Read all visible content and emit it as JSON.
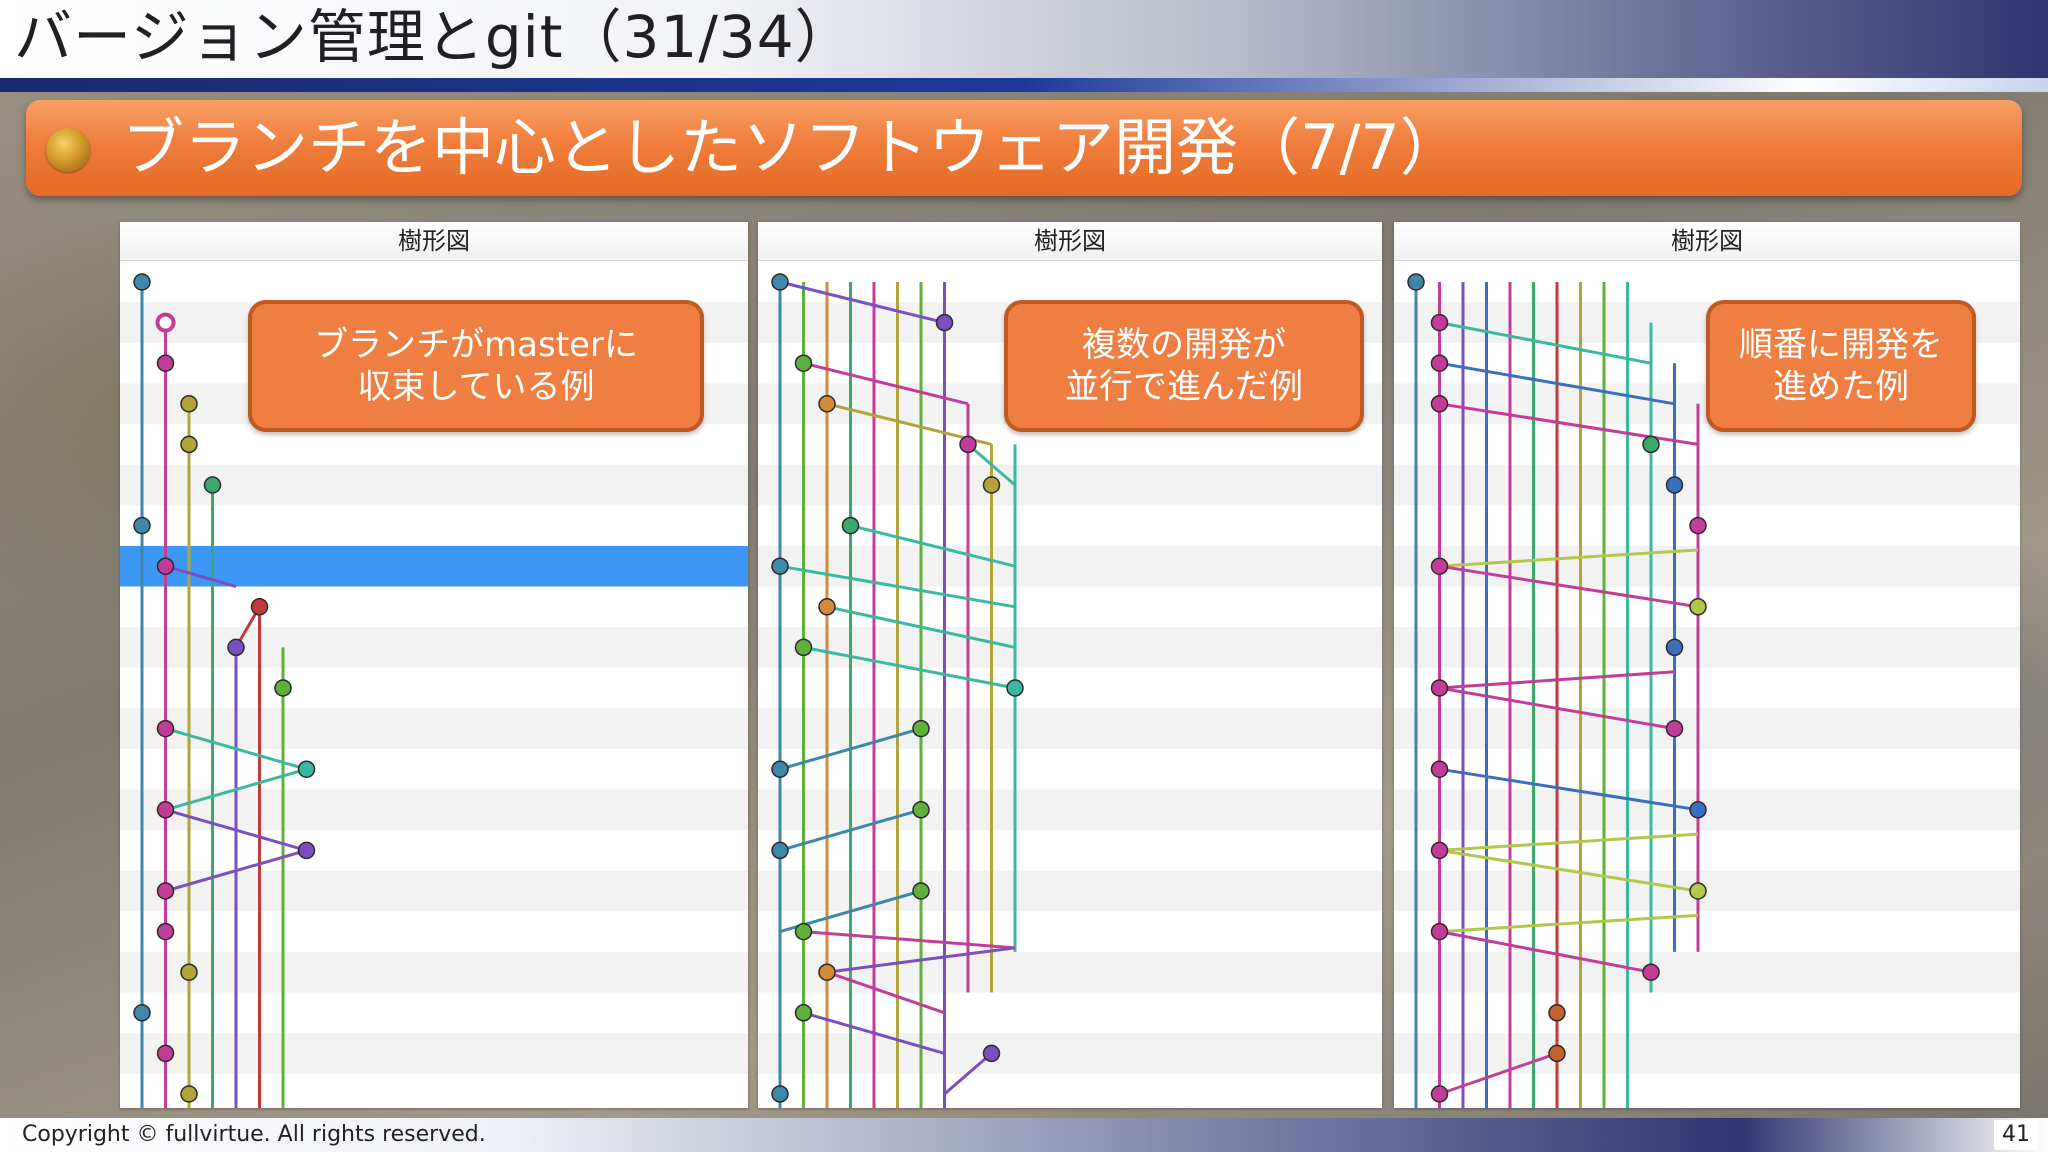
{
  "slide": {
    "title": "バージョン管理とgit（31/34）",
    "section_heading": "ブランチを中心としたソフトウェア開発（7/7）",
    "footer": "Copyright © fullvirtue.  All rights reserved.",
    "page_number": "41"
  },
  "panels": [
    {
      "header": "樹形図",
      "callout": "ブランチがmasterに\n収束している例",
      "selected_row": 7,
      "lanes": [
        {
          "color": "#3f87a8",
          "from": 0,
          "to": 20
        },
        {
          "color": "#c43c9a",
          "from": 1,
          "to": 20
        },
        {
          "color": "#b2a43a",
          "from": 3,
          "to": 20
        },
        {
          "color": "#3ca86e",
          "from": 5,
          "to": 20
        },
        {
          "color": "#7a4fc0",
          "from": 9,
          "to": 20
        },
        {
          "color": "#c23b3b",
          "from": 8,
          "to": 20
        },
        {
          "color": "#5fb03a",
          "from": 10,
          "to": 20
        }
      ],
      "commits": [
        {
          "row": 0,
          "lane": 0,
          "color": "#3f87a8"
        },
        {
          "row": 1,
          "lane": 1,
          "color": "#c43c9a",
          "hollow": true
        },
        {
          "row": 2,
          "lane": 1,
          "color": "#c43c9a"
        },
        {
          "row": 3,
          "lane": 2,
          "color": "#b2a43a"
        },
        {
          "row": 4,
          "lane": 2,
          "color": "#b2a43a"
        },
        {
          "row": 5,
          "lane": 3,
          "color": "#3ca86e"
        },
        {
          "row": 6,
          "lane": 0,
          "color": "#3f87a8"
        },
        {
          "row": 7,
          "lane": 1,
          "color": "#c43c9a"
        },
        {
          "row": 8,
          "lane": 5,
          "color": "#c23b3b"
        },
        {
          "row": 9,
          "lane": 4,
          "color": "#7a4fc0"
        },
        {
          "row": 10,
          "lane": 6,
          "color": "#5fb03a"
        },
        {
          "row": 11,
          "lane": 1,
          "color": "#c43c9a"
        },
        {
          "row": 12,
          "lane": 7,
          "color": "#3bb8a0"
        },
        {
          "row": 13,
          "lane": 1,
          "color": "#c43c9a"
        },
        {
          "row": 14,
          "lane": 7,
          "color": "#7a4fc0"
        },
        {
          "row": 15,
          "lane": 1,
          "color": "#c43c9a"
        },
        {
          "row": 16,
          "lane": 1,
          "color": "#c43c9a"
        },
        {
          "row": 17,
          "lane": 2,
          "color": "#b2a43a"
        },
        {
          "row": 18,
          "lane": 0,
          "color": "#3f87a8"
        },
        {
          "row": 19,
          "lane": 1,
          "color": "#c43c9a"
        },
        {
          "row": 20,
          "lane": 2,
          "color": "#b2a43a"
        }
      ],
      "links": [
        {
          "r1": 7,
          "l1": 1,
          "r2": 7.5,
          "l2": 4,
          "color": "#7a4fc0"
        },
        {
          "r1": 8,
          "l1": 5,
          "r2": 9,
          "l2": 4,
          "color": "#c23b3b"
        },
        {
          "r1": 9,
          "l1": 6,
          "r2": 10,
          "l2": 6,
          "color": "#5fb03a"
        },
        {
          "r1": 11,
          "l1": 1,
          "r2": 12,
          "l2": 7,
          "color": "#3bb8a0"
        },
        {
          "r1": 12,
          "l1": 7,
          "r2": 13,
          "l2": 1,
          "color": "#3bb8a0"
        },
        {
          "r1": 13,
          "l1": 1,
          "r2": 14,
          "l2": 7,
          "color": "#7a4fc0"
        },
        {
          "r1": 14,
          "l1": 7,
          "r2": 15,
          "l2": 1,
          "color": "#7a4fc0"
        }
      ]
    },
    {
      "header": "樹形図",
      "callout": "複数の開発が\n並行で進んだ例",
      "selected_row": -1,
      "lanes": [
        {
          "color": "#3f87a8",
          "from": 0,
          "to": 20
        },
        {
          "color": "#5fb03a",
          "from": 0,
          "to": 20
        },
        {
          "color": "#d08a3a",
          "from": 0,
          "to": 20
        },
        {
          "color": "#3ca86e",
          "from": 0,
          "to": 20
        },
        {
          "color": "#c43c9a",
          "from": 0,
          "to": 20
        },
        {
          "color": "#b2a43a",
          "from": 0,
          "to": 20
        },
        {
          "color": "#5fb03a",
          "from": 0,
          "to": 20
        },
        {
          "color": "#7a4fc0",
          "from": 0,
          "to": 20
        },
        {
          "color": "#c43c9a",
          "from": 3,
          "to": 17
        },
        {
          "color": "#b2a43a",
          "from": 4,
          "to": 17
        },
        {
          "color": "#3bb8a0",
          "from": 4,
          "to": 16
        }
      ],
      "commits": [
        {
          "row": 0,
          "lane": 0,
          "color": "#3f87a8"
        },
        {
          "row": 1,
          "lane": 7,
          "color": "#7a4fc0"
        },
        {
          "row": 2,
          "lane": 1,
          "color": "#5fb03a"
        },
        {
          "row": 3,
          "lane": 2,
          "color": "#d08a3a"
        },
        {
          "row": 4,
          "lane": 8,
          "color": "#c43c9a"
        },
        {
          "row": 5,
          "lane": 9,
          "color": "#b2a43a"
        },
        {
          "row": 6,
          "lane": 3,
          "color": "#3ca86e"
        },
        {
          "row": 7,
          "lane": 0,
          "color": "#3f87a8"
        },
        {
          "row": 8,
          "lane": 2,
          "color": "#d08a3a"
        },
        {
          "row": 9,
          "lane": 1,
          "color": "#5fb03a"
        },
        {
          "row": 10,
          "lane": 10,
          "color": "#3bb8a0"
        },
        {
          "row": 11,
          "lane": 6,
          "color": "#5fb03a"
        },
        {
          "row": 12,
          "lane": 0,
          "color": "#3f87a8"
        },
        {
          "row": 13,
          "lane": 6,
          "color": "#5fb03a"
        },
        {
          "row": 14,
          "lane": 0,
          "color": "#3f87a8"
        },
        {
          "row": 15,
          "lane": 6,
          "color": "#5fb03a"
        },
        {
          "row": 16,
          "lane": 1,
          "color": "#5fb03a"
        },
        {
          "row": 17,
          "lane": 2,
          "color": "#d08a3a"
        },
        {
          "row": 18,
          "lane": 1,
          "color": "#5fb03a"
        },
        {
          "row": 19,
          "lane": 9,
          "color": "#7a4fc0"
        },
        {
          "row": 20,
          "lane": 0,
          "color": "#3f87a8"
        }
      ],
      "links": [
        {
          "r1": 0,
          "l1": 0,
          "r2": 1,
          "l2": 7,
          "color": "#7a4fc0"
        },
        {
          "r1": 2,
          "l1": 1,
          "r2": 3,
          "l2": 8,
          "color": "#c43c9a"
        },
        {
          "r1": 3,
          "l1": 2,
          "r2": 4,
          "l2": 9,
          "color": "#b2a43a"
        },
        {
          "r1": 4,
          "l1": 8,
          "r2": 5,
          "l2": 10,
          "color": "#3bb8a0"
        },
        {
          "r1": 6,
          "l1": 3,
          "r2": 7,
          "l2": 10,
          "color": "#3bb8a0"
        },
        {
          "r1": 7,
          "l1": 0,
          "r2": 8,
          "l2": 10,
          "color": "#3bb8a0"
        },
        {
          "r1": 8,
          "l1": 2,
          "r2": 9,
          "l2": 10,
          "color": "#3bb8a0"
        },
        {
          "r1": 9,
          "l1": 1,
          "r2": 10,
          "l2": 10,
          "color": "#3bb8a0"
        },
        {
          "r1": 12,
          "l1": 0,
          "r2": 11,
          "l2": 6,
          "color": "#3f87a8"
        },
        {
          "r1": 14,
          "l1": 0,
          "r2": 13,
          "l2": 6,
          "color": "#3f87a8"
        },
        {
          "r1": 16,
          "l1": 0,
          "r2": 15,
          "l2": 6,
          "color": "#3f87a8"
        },
        {
          "r1": 16,
          "l1": 1,
          "r2": 16.4,
          "l2": 10,
          "color": "#c43c9a"
        },
        {
          "r1": 17,
          "l1": 2,
          "r2": 16.4,
          "l2": 10,
          "color": "#7a4fc0"
        },
        {
          "r1": 17,
          "l1": 2,
          "r2": 18,
          "l2": 7,
          "color": "#c43c9a"
        },
        {
          "r1": 18,
          "l1": 1,
          "r2": 19,
          "l2": 7,
          "color": "#7a4fc0"
        },
        {
          "r1": 20,
          "l1": 7,
          "r2": 19,
          "l2": 9,
          "color": "#7a4fc0"
        }
      ]
    },
    {
      "header": "樹形図",
      "callout": "順番に開発を\n進めた例",
      "selected_row": -1,
      "lanes": [
        {
          "color": "#3f87a8",
          "from": 0,
          "to": 20
        },
        {
          "color": "#c43c9a",
          "from": 0,
          "to": 20
        },
        {
          "color": "#7a4fc0",
          "from": 0,
          "to": 20
        },
        {
          "color": "#3a6fc0",
          "from": 0,
          "to": 20
        },
        {
          "color": "#c43c9a",
          "from": 0,
          "to": 20
        },
        {
          "color": "#3ca86e",
          "from": 0,
          "to": 20
        },
        {
          "color": "#c23b3b",
          "from": 0,
          "to": 20
        },
        {
          "color": "#b2a43a",
          "from": 0,
          "to": 20
        },
        {
          "color": "#5fb03a",
          "from": 0,
          "to": 20
        },
        {
          "color": "#3bb8a0",
          "from": 0,
          "to": 20
        },
        {
          "color": "#3bb8a0",
          "from": 1,
          "to": 17
        },
        {
          "color": "#3a6fc0",
          "from": 2,
          "to": 16
        },
        {
          "color": "#c43c9a",
          "from": 3,
          "to": 16
        }
      ],
      "commits": [
        {
          "row": 0,
          "lane": 0,
          "color": "#3f87a8"
        },
        {
          "row": 1,
          "lane": 1,
          "color": "#c43c9a"
        },
        {
          "row": 2,
          "lane": 1,
          "color": "#c43c9a"
        },
        {
          "row": 3,
          "lane": 1,
          "color": "#c43c9a"
        },
        {
          "row": 4,
          "lane": 10,
          "color": "#3ca86e"
        },
        {
          "row": 5,
          "lane": 11,
          "color": "#3a6fc0"
        },
        {
          "row": 6,
          "lane": 12,
          "color": "#c43c9a"
        },
        {
          "row": 7,
          "lane": 1,
          "color": "#c43c9a"
        },
        {
          "row": 8,
          "lane": 12,
          "color": "#b2c84a"
        },
        {
          "row": 9,
          "lane": 11,
          "color": "#3a6fc0"
        },
        {
          "row": 10,
          "lane": 1,
          "color": "#c43c9a"
        },
        {
          "row": 11,
          "lane": 11,
          "color": "#c43c9a"
        },
        {
          "row": 12,
          "lane": 1,
          "color": "#c43c9a"
        },
        {
          "row": 13,
          "lane": 12,
          "color": "#3a6fc0"
        },
        {
          "row": 14,
          "lane": 1,
          "color": "#c43c9a"
        },
        {
          "row": 15,
          "lane": 12,
          "color": "#b2c84a"
        },
        {
          "row": 16,
          "lane": 1,
          "color": "#c43c9a"
        },
        {
          "row": 17,
          "lane": 10,
          "color": "#c43c9a"
        },
        {
          "row": 18,
          "lane": 6,
          "color": "#c2622e"
        },
        {
          "row": 19,
          "lane": 6,
          "color": "#c2622e"
        },
        {
          "row": 20,
          "lane": 1,
          "color": "#c43c9a"
        }
      ],
      "links": [
        {
          "r1": 1,
          "l1": 1,
          "r2": 2,
          "l2": 10,
          "color": "#3bb8a0"
        },
        {
          "r1": 2,
          "l1": 1,
          "r2": 3,
          "l2": 11,
          "color": "#3a6fc0"
        },
        {
          "r1": 3,
          "l1": 1,
          "r2": 4,
          "l2": 12,
          "color": "#c43c9a"
        },
        {
          "r1": 7,
          "l1": 1,
          "r2": 6.6,
          "l2": 12,
          "color": "#b2c84a"
        },
        {
          "r1": 7,
          "l1": 1,
          "r2": 8,
          "l2": 12,
          "color": "#c43c9a"
        },
        {
          "r1": 10,
          "l1": 1,
          "r2": 9.6,
          "l2": 11,
          "color": "#c43c9a"
        },
        {
          "r1": 10,
          "l1": 1,
          "r2": 11,
          "l2": 11,
          "color": "#c43c9a"
        },
        {
          "r1": 12,
          "l1": 1,
          "r2": 13,
          "l2": 12,
          "color": "#3a6fc0"
        },
        {
          "r1": 14,
          "l1": 1,
          "r2": 13.6,
          "l2": 12,
          "color": "#b2c84a"
        },
        {
          "r1": 14,
          "l1": 1,
          "r2": 15,
          "l2": 12,
          "color": "#b2c84a"
        },
        {
          "r1": 16,
          "l1": 1,
          "r2": 15.6,
          "l2": 12,
          "color": "#b2c84a"
        },
        {
          "r1": 16,
          "l1": 1,
          "r2": 17,
          "l2": 10,
          "color": "#c43c9a"
        },
        {
          "r1": 20,
          "l1": 1,
          "r2": 19,
          "l2": 6,
          "color": "#c43c9a"
        }
      ]
    }
  ]
}
